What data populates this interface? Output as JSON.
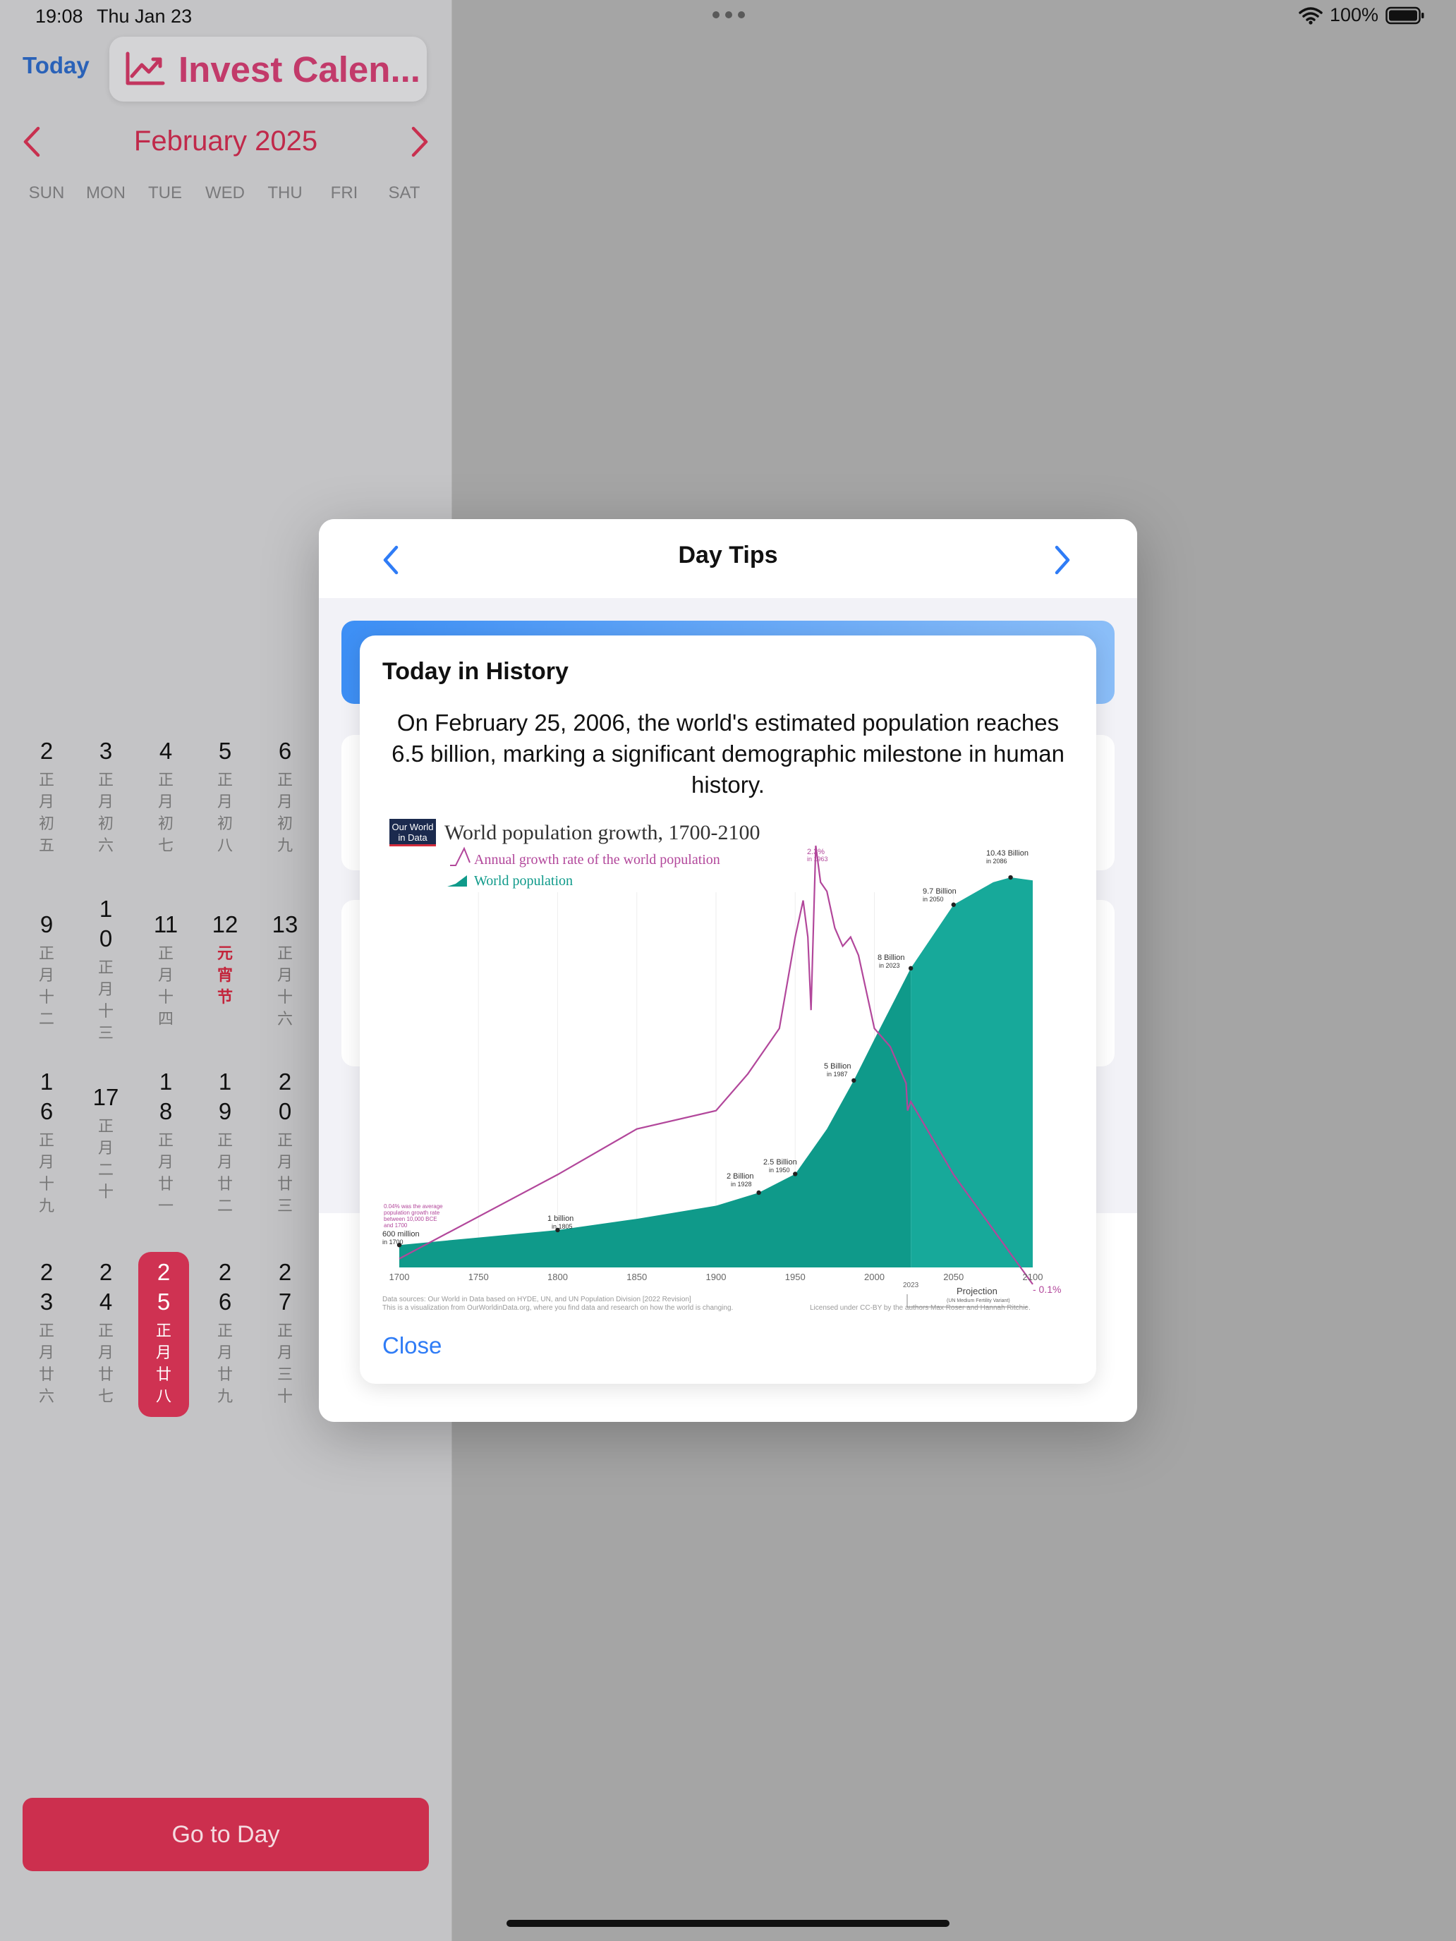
{
  "status": {
    "time": "19:08",
    "date": "Thu Jan 23",
    "battery": "100%"
  },
  "calendar": {
    "today_label": "Today",
    "app_title": "Invest Calen...",
    "month_title": "February 2025",
    "weekdays": [
      "SUN",
      "MON",
      "TUE",
      "WED",
      "THU",
      "FRI",
      "SAT"
    ],
    "go_to_day_label": "Go to Day",
    "weeks": [
      [
        {
          "day": "2",
          "lunar": "正月初五"
        },
        {
          "day": "3",
          "lunar": "正月初六"
        },
        {
          "day": "4",
          "lunar": "正月初七"
        },
        {
          "day": "5",
          "lunar": "正月初八"
        },
        {
          "day": "6",
          "lunar": "正月初九"
        }
      ],
      [
        {
          "day": "9",
          "lunar": "正月十二"
        },
        {
          "day": "10",
          "lunar": "正月十三"
        },
        {
          "day": "11",
          "lunar": "正月十四"
        },
        {
          "day": "12",
          "lunar": "元宵节",
          "festival": true
        },
        {
          "day": "13",
          "lunar": "正月十六"
        }
      ],
      [
        {
          "day": "16",
          "lunar": "正月十九"
        },
        {
          "day": "17",
          "lunar": "正月二十"
        },
        {
          "day": "18",
          "lunar": "正月廿一"
        },
        {
          "day": "19",
          "lunar": "正月廿二"
        },
        {
          "day": "20",
          "lunar": "正月廿三"
        }
      ],
      [
        {
          "day": "23",
          "lunar": "正月廿六"
        },
        {
          "day": "24",
          "lunar": "正月廿七"
        },
        {
          "day": "25",
          "lunar": "正月廿八",
          "selected": true
        },
        {
          "day": "26",
          "lunar": "正月廿九"
        },
        {
          "day": "27",
          "lunar": "正月三十"
        }
      ]
    ]
  },
  "modal": {
    "title": "Day Tips",
    "history": {
      "heading": "Today in History",
      "text": "On February 25, 2006, the world's estimated population reaches 6.5 billion, marking a significant demographic milestone in human history.",
      "close_label": "Close"
    }
  },
  "chart_data": {
    "type": "area",
    "logo_text": [
      "Our World",
      "in Data"
    ],
    "title": "World population growth, 1700-2100",
    "legend": [
      "Annual growth rate of the world population",
      "World population"
    ],
    "x_ticks": [
      "1700",
      "1750",
      "1800",
      "1850",
      "1900",
      "1950",
      "2000",
      "2023",
      "2050",
      "2100"
    ],
    "xlim": [
      1700,
      2100
    ],
    "population_billion": {
      "x": [
        1700,
        1750,
        1800,
        1850,
        1900,
        1927,
        1950,
        1970,
        1987,
        2000,
        2023,
        2050,
        2075,
        2086,
        2100
      ],
      "y": [
        0.6,
        0.8,
        1.0,
        1.3,
        1.65,
        2.0,
        2.5,
        3.7,
        5.0,
        6.1,
        8.0,
        9.7,
        10.3,
        10.43,
        10.35
      ]
    },
    "growth_rate_percent": {
      "x": [
        1700,
        1800,
        1850,
        1900,
        1920,
        1940,
        1950,
        1955,
        1958,
        1960,
        1963,
        1966,
        1970,
        1975,
        1980,
        1985,
        1990,
        2000,
        2010,
        2020,
        2021,
        2023,
        2050,
        2075,
        2100
      ],
      "y": [
        0.04,
        0.5,
        0.75,
        0.85,
        1.05,
        1.3,
        1.8,
        2.0,
        1.8,
        1.4,
        2.3,
        2.1,
        2.05,
        1.85,
        1.75,
        1.8,
        1.7,
        1.3,
        1.2,
        1.0,
        0.85,
        0.9,
        0.5,
        0.2,
        -0.1
      ]
    },
    "annotations": {
      "start": [
        "600 million",
        "in 1700"
      ],
      "a1805": [
        "1 billion",
        "in 1805"
      ],
      "a1928": [
        "2 Billion",
        "in 1928"
      ],
      "a1960": [
        "2.5 Billion",
        "in 1950"
      ],
      "a1987": [
        "5 Billion",
        "in 1987"
      ],
      "a2023": [
        "8 Billion",
        "in 2023"
      ],
      "a2050": [
        "9.7 Billion",
        "in 2050"
      ],
      "a2086": [
        "10.43 Billion",
        "in 2086"
      ],
      "peak": [
        "2.3%",
        "in 1963"
      ],
      "rate_note": [
        "0.04% was the average",
        "population growth rate",
        "between 10,000 BCE",
        "and 1700"
      ],
      "end_rate": "- 0.1%",
      "projection": "Projection",
      "projection_sub": "(UN Medium Fertility Variant)"
    },
    "sources": "Data sources: Our World in Data based on HYDE, UN, and UN Population Division [2022 Revision]",
    "visualization": "This is a visualization from OurWorldinData.org, where you find data and research on how the world is changing.",
    "license": "Licensed under CC-BY by the authors Max Roser and Hannah Ritchie.",
    "colors": {
      "area": "#0f9a8a",
      "area_projection": "#17a99a",
      "rate": "#b2479b"
    }
  }
}
